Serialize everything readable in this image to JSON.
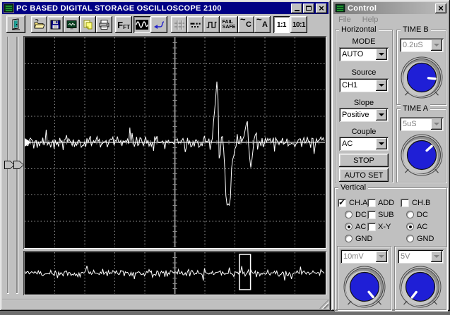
{
  "main_window": {
    "title": "PC BASED DIGITAL STORAGE OSCILLOSCOPE 2100",
    "titlebar_color": "#000084"
  },
  "toolbar": {
    "fft_main": "F",
    "fft_sub": "FT",
    "fail_safe": {
      "line1": "FAIL",
      "line2": "SAFE"
    },
    "couple_c": {
      "tilde": "~",
      "letter": "C"
    },
    "couple_a": {
      "tilde": "~",
      "letter": "A"
    },
    "probe_1to1": "1:1",
    "probe_10to1": "10:1"
  },
  "scope": {
    "colors": {
      "bg": "#000000",
      "grid": "#9a9a9a",
      "axis": "#8c8c8c",
      "trace": "#ffffff"
    },
    "main": {
      "hdiv": 10,
      "vdiv": 8,
      "minor": 5,
      "seed": 20,
      "noise": 8,
      "spike_prob": 0.1,
      "spike_scale": 16,
      "baseline_frac": 0.5,
      "center_h": true,
      "trigger": true,
      "event": [
        [
          0.598,
          0
        ],
        [
          0.61,
          -0.03
        ],
        [
          0.622,
          0.02
        ],
        [
          0.63,
          -0.08
        ],
        [
          0.642,
          -0.315
        ],
        [
          0.648,
          0.1
        ],
        [
          0.654,
          0.02
        ],
        [
          0.658,
          -0.06
        ],
        [
          0.664,
          0.1
        ],
        [
          0.672,
          0.295
        ],
        [
          0.683,
          0.315
        ],
        [
          0.69,
          0.12
        ],
        [
          0.698,
          0.05
        ],
        [
          0.706,
          -0.02
        ],
        [
          0.715,
          0
        ],
        [
          0.733,
          -0.02
        ],
        [
          0.742,
          -0.12
        ],
        [
          0.75,
          0.13
        ],
        [
          0.758,
          0.08
        ],
        [
          0.766,
          -0.04
        ],
        [
          0.775,
          0
        ]
      ]
    },
    "zoom_strip": {
      "hdiv": 10,
      "minor": 5,
      "seed": 99,
      "noise": 4.5,
      "spike_prob": 0.13,
      "spike_scale": 10,
      "baseline_frac": 0.5,
      "center_h": false,
      "select_rect": {
        "x_frac": 0.715,
        "w_frac": 0.037
      }
    }
  },
  "control_window": {
    "title": "Control",
    "menu": [
      {
        "label": "File"
      },
      {
        "label": "Help"
      }
    ],
    "knob_color": "#1f1fd6",
    "horizontal": {
      "label": "Horizontal",
      "mode_label": "MODE",
      "mode_value": "AUTO",
      "source_label": "Source",
      "source_value": "CH1",
      "slope_label": "Slope",
      "slope_value": "Positive",
      "couple_label": "Couple",
      "couple_value": "AC",
      "stop_button": "STOP",
      "auto_set_button": "AUTO SET"
    },
    "time_b": {
      "label": "TIME B",
      "value": "0.2uS",
      "knob_deg": 95
    },
    "time_a": {
      "label": "TIME A",
      "value": "5uS",
      "knob_deg": 48
    },
    "vertical": {
      "label": "Vertical",
      "ch_a": {
        "label": "CH.A",
        "checked": true,
        "coupling": "AC",
        "volts": "10mV",
        "knob_deg": 140
      },
      "ch_b": {
        "label": "CH.B",
        "checked": false,
        "coupling": "AC",
        "volts": "5V",
        "knob_deg": 218
      },
      "add": {
        "label": "ADD",
        "checked": false
      },
      "sub": {
        "label": "SUB",
        "checked": false
      },
      "xy": {
        "label": "X-Y",
        "checked": false
      },
      "coupling_options": [
        "DC",
        "AC",
        "GND"
      ]
    }
  }
}
